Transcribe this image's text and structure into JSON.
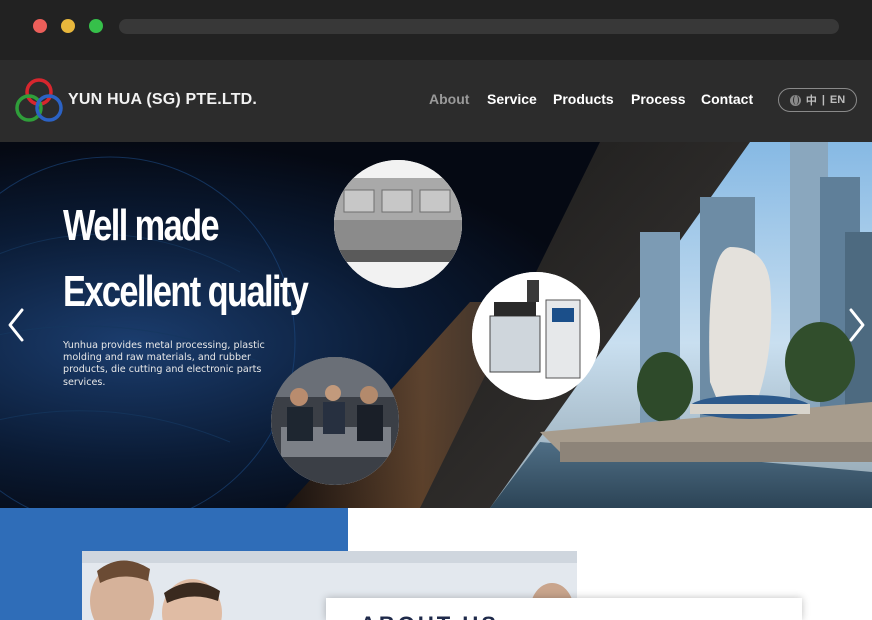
{
  "brand": {
    "name": "YUN HUA (SG) PTE.LTD."
  },
  "nav": {
    "items": [
      "About",
      "Service",
      "Products",
      "Process",
      "Contact"
    ],
    "active": "About",
    "language": {
      "icon": "globe-icon",
      "zh": "中",
      "separator": "|",
      "en": "EN"
    }
  },
  "hero": {
    "line1": "Well made",
    "line2": "Excellent quality",
    "description": "Yunhua provides metal processing, plastic molding and raw materials, and rubber products, die cutting and electronic parts services.",
    "prev_icon": "chevron-left-icon",
    "next_icon": "chevron-right-icon"
  },
  "about": {
    "title": "ABOUT US"
  },
  "colors": {
    "header_bg": "#2c2c2c",
    "hero_bg": "#050913",
    "accent_blue": "#2f6db8",
    "nav_active": "#9a9a9a"
  }
}
